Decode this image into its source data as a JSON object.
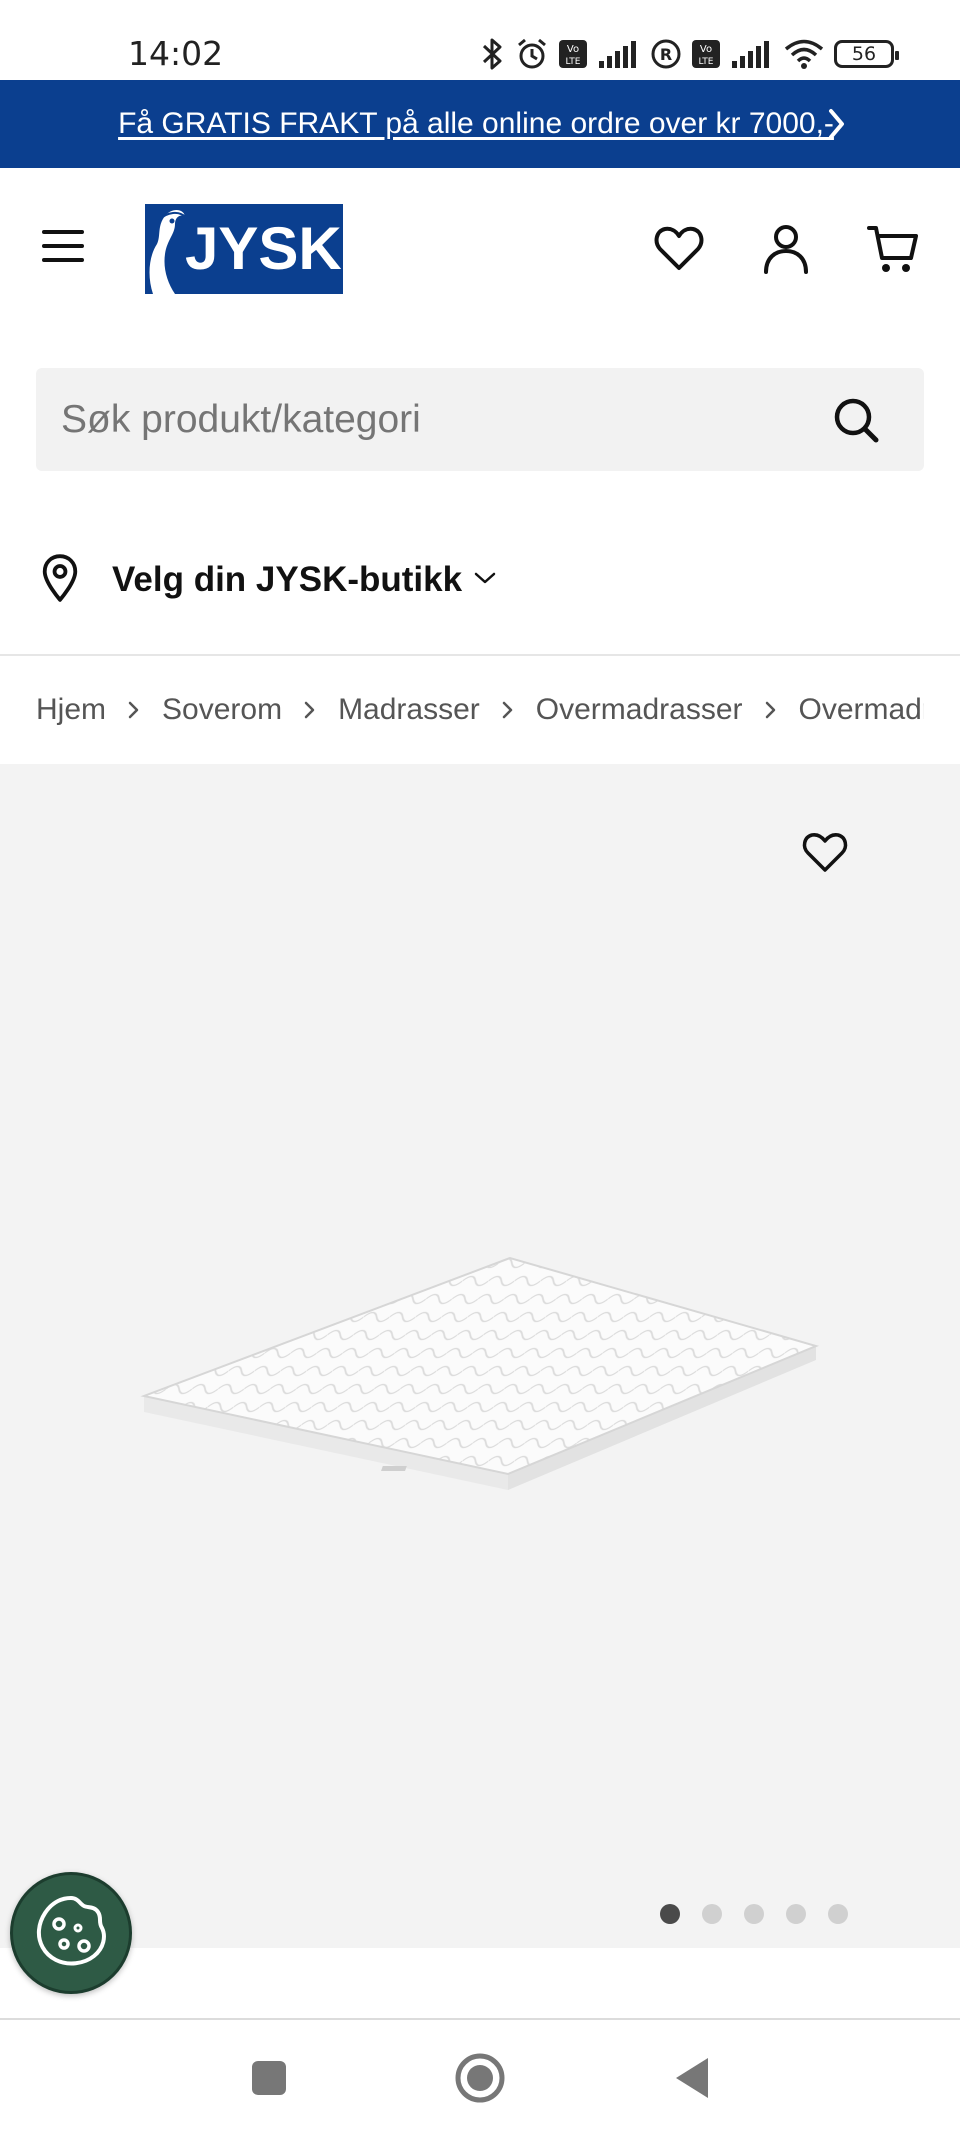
{
  "status_bar": {
    "time": "14:02",
    "battery": "56",
    "icons": [
      "bluetooth-icon",
      "alarm-icon",
      "volte-icon",
      "signal-icon",
      "roaming-icon",
      "volte-icon",
      "signal-icon",
      "wifi-icon",
      "battery-icon"
    ]
  },
  "promo": {
    "text": "Få GRATIS FRAKT på alle online ordre over kr 7000,-",
    "chevron_icon": "chevron-right-icon",
    "background": "#0b3f8f"
  },
  "header": {
    "logo_text": "JYSK",
    "icons": [
      "menu-icon",
      "heart-icon",
      "user-icon",
      "cart-icon"
    ]
  },
  "search": {
    "placeholder": "Søk produkt/kategori",
    "icon": "search-icon"
  },
  "store": {
    "label": "Velg din JYSK-butikk",
    "icons": [
      "location-pin-icon",
      "chevron-down-icon"
    ]
  },
  "breadcrumb": {
    "items": [
      "Hjem",
      "Soverom",
      "Madrasser",
      "Overmadrasser",
      "Overmadrasser"
    ]
  },
  "gallery": {
    "slide_count": 5,
    "active_slide": 1,
    "favorite_icon": "heart-icon"
  },
  "cookie": {
    "icon": "cookie-icon",
    "color": "#2e5a45"
  },
  "nav_bar": {
    "icons": [
      "recents-icon",
      "home-icon",
      "back-icon"
    ]
  }
}
